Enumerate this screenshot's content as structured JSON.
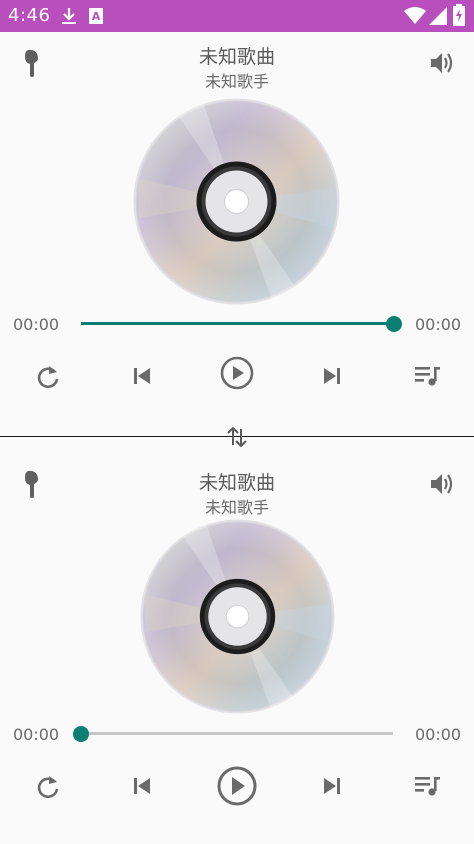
{
  "status_bar": {
    "time": "4:46",
    "icons": [
      "download-icon",
      "a-box-icon",
      "wifi-icon",
      "signal-icon",
      "battery-icon"
    ],
    "bg_color": "#b84fbc"
  },
  "player_top": {
    "title": "未知歌曲",
    "artist": "未知歌手",
    "elapsed": "00:00",
    "duration": "00:00",
    "progress": 1.0,
    "icons": {
      "left": "earphone-icon",
      "right": "volume-icon",
      "controls": [
        "repeat-icon",
        "skip-previous-icon",
        "play-icon",
        "skip-next-icon",
        "playlist-icon"
      ]
    }
  },
  "switch_icon": "swap-vertical-icon",
  "player_bottom": {
    "title": "未知歌曲",
    "artist": "未知歌手",
    "elapsed": "00:00",
    "duration": "00:00",
    "progress": 0.0,
    "icons": {
      "left": "earphone-icon",
      "right": "volume-icon",
      "controls": [
        "repeat-icon",
        "skip-previous-icon",
        "play-icon",
        "skip-next-icon",
        "playlist-icon"
      ]
    }
  },
  "colors": {
    "accent": "#0b7f73",
    "track_inactive": "#c8c8c8",
    "icon": "#666666"
  }
}
